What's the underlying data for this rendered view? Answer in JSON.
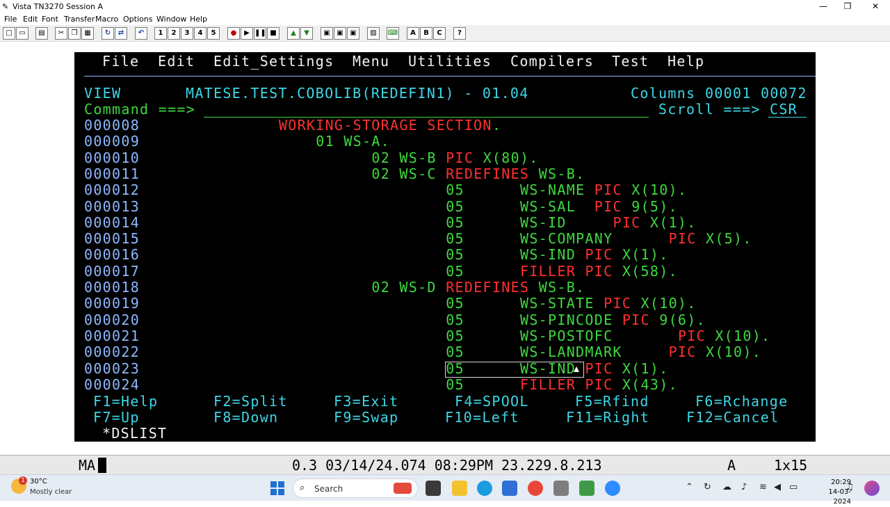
{
  "window": {
    "title": "Vista TN3270 Session A",
    "min": "—",
    "max": "❐",
    "close": "✕"
  },
  "menu": [
    "File",
    "Edit",
    "Font",
    "Transfer",
    "Macro",
    "Options",
    "Window",
    "Help"
  ],
  "toolbar": {
    "macro_buttons": [
      "1",
      "2",
      "3",
      "4",
      "5"
    ],
    "letter_buttons": [
      "A",
      "B",
      "C"
    ],
    "help_button": "?"
  },
  "ispf": {
    "action_bar": [
      "File",
      "Edit",
      "Edit_Settings",
      "Menu",
      "Utilities",
      "Compilers",
      "Test",
      "Help"
    ],
    "mode": "VIEW",
    "dataset": "MATESE.TEST.COBOLIB(REDEFIN1) - 01.04",
    "columns_label": "Columns",
    "col_start": "00001",
    "col_end": "00072",
    "command_prompt": "Command ===>",
    "scroll_prompt": "Scroll ===>",
    "scroll_value": "CSR",
    "lines": [
      {
        "num": "000008",
        "segs": [
          {
            "t": "WORKING-STORAGE SECTION",
            "c": "rd",
            "col": 14
          },
          {
            "t": ".",
            "c": "g",
            "col": 37
          }
        ]
      },
      {
        "num": "000009",
        "segs": [
          {
            "t": "01 WS-A.",
            "c": "g",
            "col": 18
          }
        ]
      },
      {
        "num": "000010",
        "segs": [
          {
            "t": "02 WS-B",
            "c": "g",
            "col": 24
          },
          {
            "t": "PIC",
            "c": "rd",
            "col": 32
          },
          {
            "t": "X(80).",
            "c": "g",
            "col": 36
          }
        ]
      },
      {
        "num": "000011",
        "segs": [
          {
            "t": "02 WS-C",
            "c": "g",
            "col": 24
          },
          {
            "t": "REDEFINES",
            "c": "rd",
            "col": 32
          },
          {
            "t": "WS-B.",
            "c": "g",
            "col": 42
          }
        ]
      },
      {
        "num": "000012",
        "segs": [
          {
            "t": "05",
            "c": "g",
            "col": 32
          },
          {
            "t": "WS-NAME",
            "c": "g",
            "col": 40
          },
          {
            "t": "PIC",
            "c": "rd",
            "col": 48
          },
          {
            "t": "X(10).",
            "c": "g",
            "col": 52
          }
        ]
      },
      {
        "num": "000013",
        "segs": [
          {
            "t": "05",
            "c": "g",
            "col": 32
          },
          {
            "t": "WS-SAL",
            "c": "g",
            "col": 40
          },
          {
            "t": "PIC",
            "c": "rd",
            "col": 48
          },
          {
            "t": "9(5).",
            "c": "g",
            "col": 52
          }
        ]
      },
      {
        "num": "000014",
        "segs": [
          {
            "t": "05",
            "c": "g",
            "col": 32
          },
          {
            "t": "WS-ID",
            "c": "g",
            "col": 40
          },
          {
            "t": "PIC",
            "c": "rd",
            "col": 50
          },
          {
            "t": "X(1).",
            "c": "g",
            "col": 54
          }
        ]
      },
      {
        "num": "000015",
        "segs": [
          {
            "t": "05",
            "c": "g",
            "col": 32
          },
          {
            "t": "WS-COMPANY",
            "c": "g",
            "col": 40
          },
          {
            "t": "PIC",
            "c": "rd",
            "col": 56
          },
          {
            "t": "X(5).",
            "c": "g",
            "col": 60
          }
        ]
      },
      {
        "num": "000016",
        "segs": [
          {
            "t": "05",
            "c": "g",
            "col": 32
          },
          {
            "t": "WS-IND",
            "c": "g",
            "col": 40
          },
          {
            "t": "PIC",
            "c": "rd",
            "col": 47
          },
          {
            "t": "X(1).",
            "c": "g",
            "col": 51
          }
        ]
      },
      {
        "num": "000017",
        "segs": [
          {
            "t": "05",
            "c": "g",
            "col": 32
          },
          {
            "t": "FILLER",
            "c": "rd",
            "col": 40
          },
          {
            "t": "PIC",
            "c": "rd",
            "col": 47
          },
          {
            "t": "X(58).",
            "c": "g",
            "col": 51
          }
        ]
      },
      {
        "num": "000018",
        "segs": [
          {
            "t": "02 WS-D",
            "c": "g",
            "col": 24
          },
          {
            "t": "REDEFINES",
            "c": "rd",
            "col": 32
          },
          {
            "t": "WS-B.",
            "c": "g",
            "col": 42
          }
        ]
      },
      {
        "num": "000019",
        "segs": [
          {
            "t": "05",
            "c": "g",
            "col": 32
          },
          {
            "t": "WS-STATE",
            "c": "g",
            "col": 40
          },
          {
            "t": "PIC",
            "c": "rd",
            "col": 49
          },
          {
            "t": "X(10).",
            "c": "g",
            "col": 53
          }
        ]
      },
      {
        "num": "000020",
        "segs": [
          {
            "t": "05",
            "c": "g",
            "col": 32
          },
          {
            "t": "WS-PINCODE",
            "c": "g",
            "col": 40
          },
          {
            "t": "PIC",
            "c": "rd",
            "col": 51
          },
          {
            "t": "9(6).",
            "c": "g",
            "col": 55
          }
        ]
      },
      {
        "num": "000021",
        "segs": [
          {
            "t": "05",
            "c": "g",
            "col": 32
          },
          {
            "t": "WS-POSTOFC",
            "c": "g",
            "col": 40
          },
          {
            "t": "PIC",
            "c": "rd",
            "col": 57
          },
          {
            "t": "X(10).",
            "c": "g",
            "col": 61
          }
        ]
      },
      {
        "num": "000022",
        "segs": [
          {
            "t": "05",
            "c": "g",
            "col": 32
          },
          {
            "t": "WS-LANDMARK",
            "c": "g",
            "col": 40
          },
          {
            "t": "PIC",
            "c": "rd",
            "col": 56
          },
          {
            "t": "X(10).",
            "c": "g",
            "col": 60
          }
        ]
      },
      {
        "num": "000023",
        "segs": [
          {
            "t": "05",
            "c": "g",
            "col": 32
          },
          {
            "t": "WS-IND",
            "c": "g",
            "col": 40
          },
          {
            "t": "PIC",
            "c": "rd",
            "col": 47
          },
          {
            "t": "X(1).",
            "c": "g",
            "col": 51
          }
        ]
      },
      {
        "num": "000024",
        "segs": [
          {
            "t": "05",
            "c": "g",
            "col": 32
          },
          {
            "t": "FILLER",
            "c": "rd",
            "col": 40
          },
          {
            "t": "PIC",
            "c": "rd",
            "col": 47
          },
          {
            "t": "X(43).",
            "c": "g",
            "col": 51
          }
        ]
      }
    ],
    "pfkeys_row1": [
      "F1=Help",
      "F2=Split",
      "F3=Exit",
      "F4=SPOOL",
      "F5=Rfind",
      "F6=Rchange"
    ],
    "pfkeys_row2": [
      "F7=Up",
      "F8=Down",
      "F9=Swap",
      "F10=Left",
      "F11=Right",
      "F12=Cancel"
    ],
    "bottom_command": "*DSLIST"
  },
  "status": {
    "ma": "MA",
    "info": "0.3 03/14/24.074 08:29PM 23.229.8.213",
    "mode": "A",
    "pos": "1x15"
  },
  "taskbar": {
    "badge": "1",
    "temperature": "30°C",
    "condition": "Mostly clear",
    "search_label": "Search",
    "time": "20:29",
    "date": "14-03-2024"
  },
  "colors": {
    "terminal_bg": "#000000",
    "green": "#3fd83f",
    "turquoise": "#3fd6e6",
    "blue": "#8fb8ff",
    "red": "#ff3030",
    "white": "#f2f2f2"
  }
}
